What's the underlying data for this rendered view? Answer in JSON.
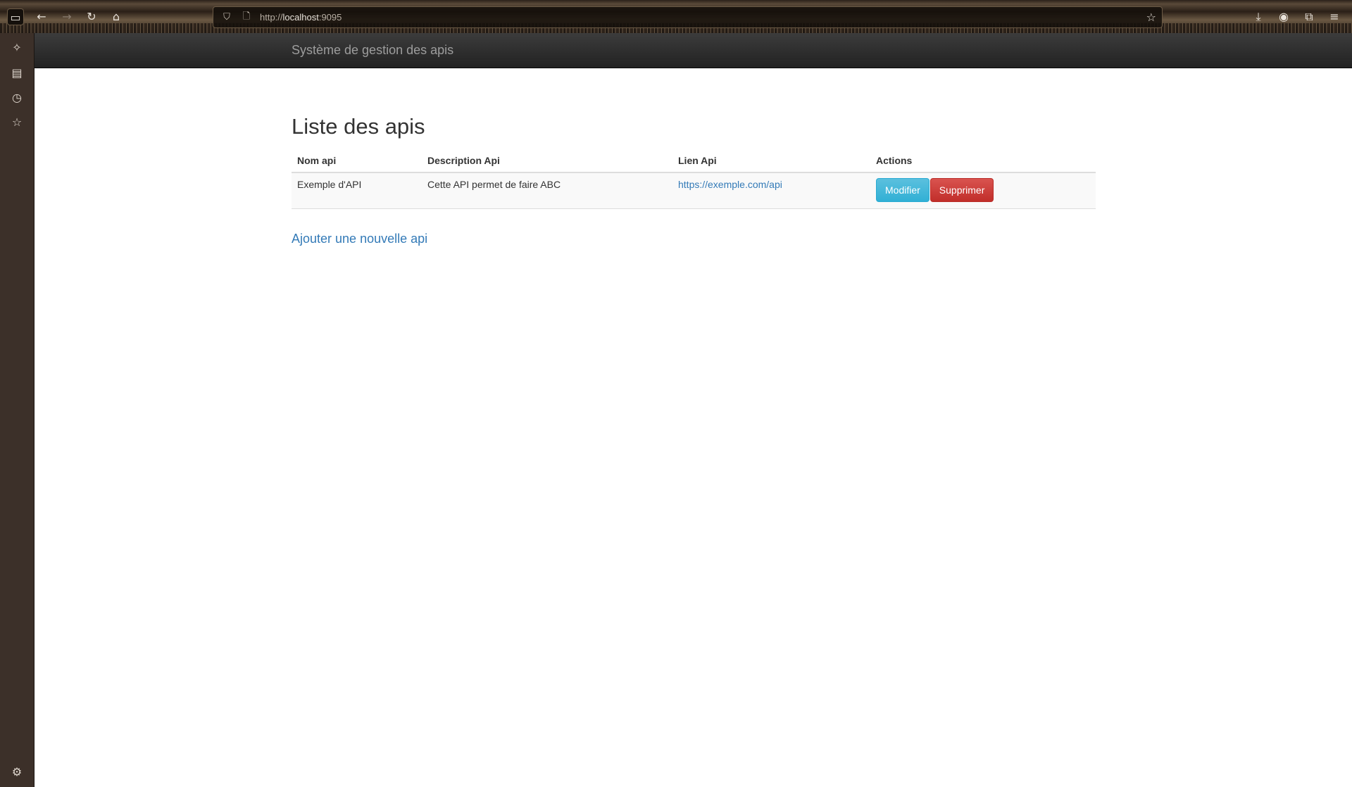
{
  "browser": {
    "url_prefix": "http://",
    "url_host": "localhost",
    "url_port": ":9095",
    "icons": {
      "sidebar_toggle": "sidebar-icon",
      "back": "arrow-left-icon",
      "forward": "arrow-right-icon",
      "reload": "reload-icon",
      "home": "home-icon",
      "shield": "shield-icon",
      "page": "page-icon",
      "bookmark": "star-icon",
      "downloads": "download-icon",
      "account": "account-icon",
      "extensions": "puzzle-icon",
      "menu": "hamburger-menu-icon"
    }
  },
  "side_rail": {
    "icons": [
      "ai-sparkle-icon",
      "sync-tabs-icon",
      "history-icon",
      "bookmarks-star-icon",
      "settings-gear-icon"
    ]
  },
  "navbar": {
    "brand": "Système de gestion des apis"
  },
  "main": {
    "title": "Liste des apis",
    "table": {
      "headers": [
        "Nom api",
        "Description Api",
        "Lien Api",
        "Actions"
      ],
      "rows": [
        {
          "name": "Exemple d'API",
          "description": "Cette API permet de faire ABC",
          "link": "https://exemple.com/api",
          "actions": [
            "Modifier",
            "Supprimer"
          ]
        }
      ]
    },
    "add_link": "Ajouter une nouvelle api"
  },
  "colors": {
    "navbar_bg": "#222222",
    "link": "#337ab7",
    "btn_info": "#5bc0de",
    "btn_danger": "#d9534f"
  }
}
